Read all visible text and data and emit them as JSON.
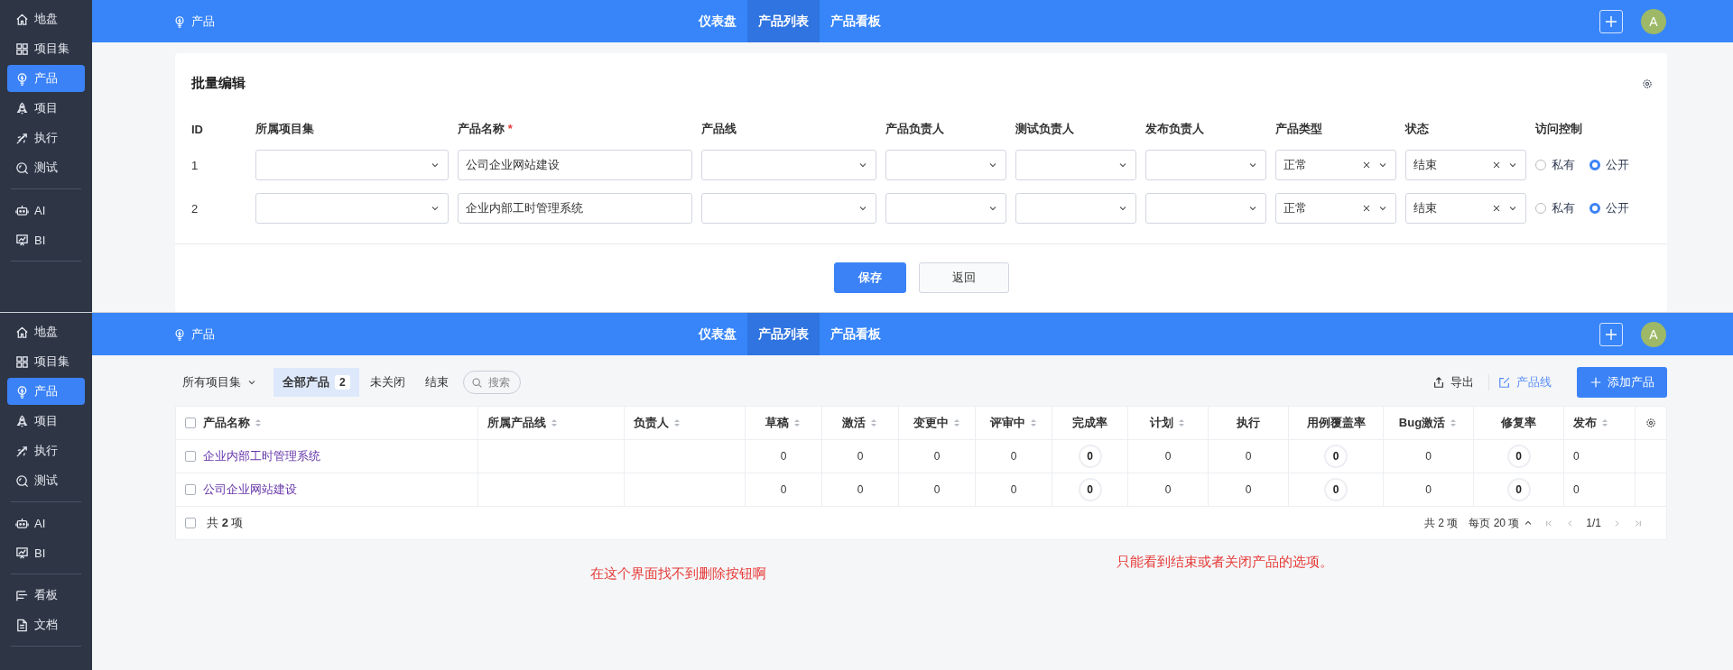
{
  "screens": [
    {
      "kind": "batch_edit",
      "sidebar": {
        "groups": [
          [
            {
              "label": "地盘",
              "selected": false
            },
            {
              "label": "项目集",
              "selected": false
            },
            {
              "label": "产品",
              "selected": true
            },
            {
              "label": "项目",
              "selected": false
            },
            {
              "label": "执行",
              "selected": false
            },
            {
              "label": "测试",
              "selected": false
            }
          ],
          [
            {
              "label": "AI",
              "selected": false
            },
            {
              "label": "BI",
              "selected": false
            }
          ]
        ]
      },
      "header": {
        "breadcrumb": "产品",
        "nav": [
          {
            "label": "仪表盘",
            "selected": false
          },
          {
            "label": "产品列表",
            "selected": true
          },
          {
            "label": "产品看板",
            "selected": false
          }
        ],
        "avatar": "A"
      },
      "batch_edit": {
        "title": "批量编辑",
        "columns": [
          {
            "label": "ID"
          },
          {
            "label": "所属项目集"
          },
          {
            "label": "产品名称",
            "required_mark": "*"
          },
          {
            "label": "产品线"
          },
          {
            "label": "产品负责人"
          },
          {
            "label": "测试负责人"
          },
          {
            "label": "发布负责人"
          },
          {
            "label": "产品类型"
          },
          {
            "label": "状态"
          },
          {
            "label": "访问控制"
          }
        ],
        "rows": [
          {
            "cells": [
              {
                "kind": "id",
                "value": "1"
              },
              {
                "kind": "select"
              },
              {
                "kind": "input",
                "value": "公司企业网站建设"
              },
              {
                "kind": "select"
              },
              {
                "kind": "select"
              },
              {
                "kind": "select"
              },
              {
                "kind": "select"
              },
              {
                "kind": "select",
                "value": "正常"
              },
              {
                "kind": "select",
                "value": "结束"
              },
              {
                "kind": "radio",
                "options": [
                  {
                    "label": "私有",
                    "selected": false
                  },
                  {
                    "label": "公开",
                    "selected": true
                  }
                ]
              }
            ]
          },
          {
            "cells": [
              {
                "kind": "id",
                "value": "2"
              },
              {
                "kind": "select"
              },
              {
                "kind": "input",
                "value": "企业内部工时管理系统"
              },
              {
                "kind": "select"
              },
              {
                "kind": "select"
              },
              {
                "kind": "select"
              },
              {
                "kind": "select"
              },
              {
                "kind": "select",
                "value": "正常"
              },
              {
                "kind": "select",
                "value": "结束"
              },
              {
                "kind": "radio",
                "options": [
                  {
                    "label": "私有",
                    "selected": false
                  },
                  {
                    "label": "公开",
                    "selected": true
                  }
                ]
              }
            ]
          }
        ],
        "buttons": [
          {
            "label": "保存",
            "kind": "primary"
          },
          {
            "label": "返回",
            "kind": "default"
          }
        ]
      }
    },
    {
      "kind": "product_list",
      "sidebar": {
        "groups": [
          [
            {
              "label": "地盘",
              "selected": false
            },
            {
              "label": "项目集",
              "selected": false
            },
            {
              "label": "产品",
              "selected": true
            },
            {
              "label": "项目",
              "selected": false
            },
            {
              "label": "执行",
              "selected": false
            },
            {
              "label": "测试",
              "selected": false
            }
          ],
          [
            {
              "label": "AI",
              "selected": false
            },
            {
              "label": "BI",
              "selected": false
            }
          ],
          [
            {
              "label": "看板",
              "selected": false
            },
            {
              "label": "文档",
              "selected": false
            }
          ]
        ]
      },
      "header": {
        "breadcrumb": "产品",
        "nav": [
          {
            "label": "仪表盘",
            "selected": false
          },
          {
            "label": "产品列表",
            "selected": true
          },
          {
            "label": "产品看板",
            "selected": false
          }
        ],
        "avatar": "A"
      },
      "product_list": {
        "program_filter": "所有项目集",
        "tabs": [
          {
            "label": "全部产品",
            "count": "2",
            "selected": true
          },
          {
            "label": "未关闭",
            "selected": false
          },
          {
            "label": "结束",
            "selected": false
          }
        ],
        "search": {
          "placeholder": "搜索"
        },
        "actions": [
          {
            "label": "导出",
            "kind": "export"
          },
          {
            "label": "产品线",
            "kind": "edit"
          },
          {
            "label": "添加产品",
            "kind": "primary"
          }
        ],
        "table": {
          "columns": [
            {
              "label": "产品名称",
              "sortable": true,
              "kind": "name"
            },
            {
              "label": "所属产品线",
              "sortable": true,
              "kind": "text"
            },
            {
              "label": "负责人",
              "sortable": true,
              "kind": "text"
            },
            {
              "label": "草稿",
              "sortable": true,
              "kind": "number"
            },
            {
              "label": "激活",
              "sortable": true,
              "kind": "number"
            },
            {
              "label": "变更中",
              "sortable": true,
              "kind": "number"
            },
            {
              "label": "评审中",
              "sortable": true,
              "kind": "number"
            },
            {
              "label": "完成率",
              "sortable": false,
              "kind": "ring"
            },
            {
              "label": "计划",
              "sortable": true,
              "kind": "number"
            },
            {
              "label": "执行",
              "sortable": false,
              "kind": "number"
            },
            {
              "label": "用例覆盖率",
              "sortable": false,
              "kind": "ring"
            },
            {
              "label": "Bug激活",
              "sortable": true,
              "kind": "number"
            },
            {
              "label": "修复率",
              "sortable": false,
              "kind": "ring"
            },
            {
              "label": "发布",
              "sortable": true,
              "kind": "text"
            }
          ],
          "all_checked": false,
          "rows": [
            {
              "checked": false,
              "cells": [
                "企业内部工时管理系统",
                null,
                null,
                "0",
                "0",
                "0",
                "0",
                "0",
                "0",
                "0",
                "0",
                "0",
                "0",
                "0"
              ]
            },
            {
              "checked": false,
              "cells": [
                "公司企业网站建设",
                null,
                null,
                "0",
                "0",
                "0",
                "0",
                "0",
                "0",
                "0",
                "0",
                "0",
                "0",
                "0"
              ]
            }
          ],
          "footer": {
            "checked": false,
            "summary": "共 **2** 项",
            "total": "共 2 项",
            "page_size": "每页 20 项",
            "page": "1/1"
          }
        }
      },
      "annotations": [
        {
          "text": "在这个界面找不到删除按钮啊"
        },
        {
          "text": "只能看到结束或者关闭产品的选项。"
        }
      ]
    }
  ]
}
